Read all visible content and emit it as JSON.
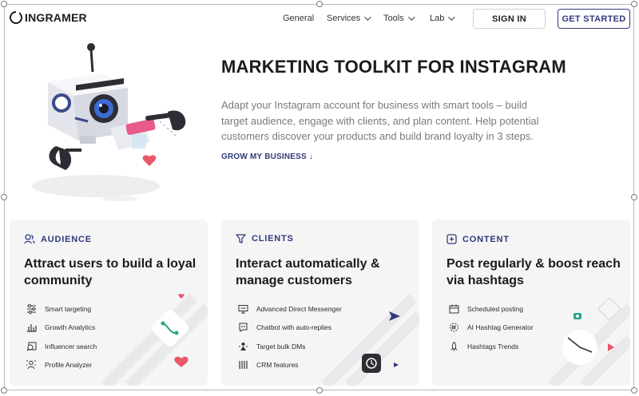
{
  "brand": {
    "name": "INGRAMER"
  },
  "nav": {
    "general": "General",
    "services": "Services",
    "tools": "Tools",
    "lab": "Lab",
    "sign_in": "SIGN IN",
    "get_started": "GET STARTED"
  },
  "hero": {
    "title": "MARKETING TOOLKIT FOR INSTAGRAM",
    "description": "Adapt your Instagram account for business with smart tools – build target audience, engage with clients, and plan content. Help potential customers discover your products and build brand loyalty in 3 steps.",
    "cta": "GROW MY BUSINESS ↓"
  },
  "cards": [
    {
      "label": "AUDIENCE",
      "icon": "people-icon",
      "title": "Attract users to build a loyal community",
      "features": [
        "Smart targeting",
        "Growth Analytics",
        "Influencer search",
        "Profile Analyzer"
      ]
    },
    {
      "label": "CLIENTS",
      "icon": "funnel-icon",
      "title": "Interact automatically & manage customers",
      "features": [
        "Advanced Direct Messenger",
        "Chatbot with auto-replies",
        "Target bulk DMs",
        "CRM features"
      ]
    },
    {
      "label": "CONTENT",
      "icon": "plus-square-icon",
      "title": "Post regularly & boost reach via hashtags",
      "features": [
        "Scheduled posting",
        "AI Hashtag Generator",
        "Hashtags Trends"
      ]
    }
  ],
  "colors": {
    "accent": "#303a7a",
    "card_bg": "#f5f5f6",
    "heart": "#e8576b",
    "teal": "#2aa58a"
  }
}
